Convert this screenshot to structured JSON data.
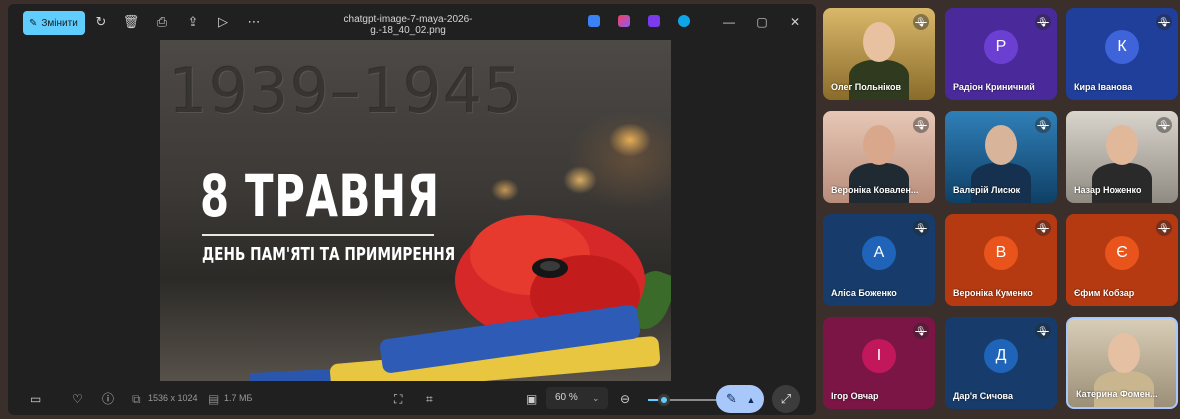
{
  "viewer": {
    "edit_label": "Змінити",
    "filename": "chatgpt-image-7-maya-2026-g.-18_40_02.png",
    "toolbar_icons": [
      "rotate-icon",
      "delete-icon",
      "print-icon",
      "share-icon",
      "slideshow-icon",
      "more-icon"
    ],
    "window_controls": [
      "minimize-icon",
      "maximize-icon",
      "close-icon"
    ],
    "image": {
      "years": "1939–1945",
      "title": "8 ТРАВНЯ",
      "subtitle": "ДЕНЬ ПАМ'ЯТІ ТА ПРИМИРЕННЯ"
    },
    "info": {
      "dimensions": "1536 x 1024",
      "size": "1.7 МБ"
    },
    "zoom": {
      "label": "60 %",
      "level": 0.2
    }
  },
  "colors": {
    "accent": "#60cdff",
    "meet_blue": "#a8c7fa",
    "tile_purple": "#4a2a9a",
    "tile_blue": "#173c6b",
    "tile_orange": "#b53a12",
    "tile_magenta": "#7a1545"
  },
  "participants": [
    {
      "name": "Олег Польніков",
      "type": "video",
      "muted": true
    },
    {
      "name": "Радіон Криничний",
      "initial": "Р",
      "avatar_color": "#6c3fd3",
      "tile_color": "#4a2a9a",
      "muted": true
    },
    {
      "name": "Кира Іванова",
      "initial": "К",
      "avatar_color": "#3f63d8",
      "tile_color": "#1f3f9a",
      "muted": true
    },
    {
      "name": "Вероніка Ковален...",
      "type": "video",
      "muted": true
    },
    {
      "name": "Валерій Лисюк",
      "type": "video",
      "muted": true
    },
    {
      "name": "Назар Ноженко",
      "type": "video",
      "muted": true
    },
    {
      "name": "Аліса Боженко",
      "initial": "А",
      "avatar_color": "#1f64b8",
      "tile_color": "#173c6b",
      "muted": true
    },
    {
      "name": "Вероніка Куменко",
      "initial": "В",
      "avatar_color": "#e8541c",
      "tile_color": "#b53a12",
      "muted": true
    },
    {
      "name": "Єфим Кобзар",
      "initial": "Є",
      "avatar_color": "#e8541c",
      "tile_color": "#b53a12",
      "muted": true
    },
    {
      "name": "Ігор Овчар",
      "initial": "І",
      "avatar_color": "#c2185b",
      "tile_color": "#7a1545",
      "muted": true
    },
    {
      "name": "Дар'я Сичова",
      "initial": "Д",
      "avatar_color": "#1f64b8",
      "tile_color": "#173c6b",
      "muted": true
    },
    {
      "name": "Катерина Фомен...",
      "type": "video",
      "muted": false
    }
  ]
}
